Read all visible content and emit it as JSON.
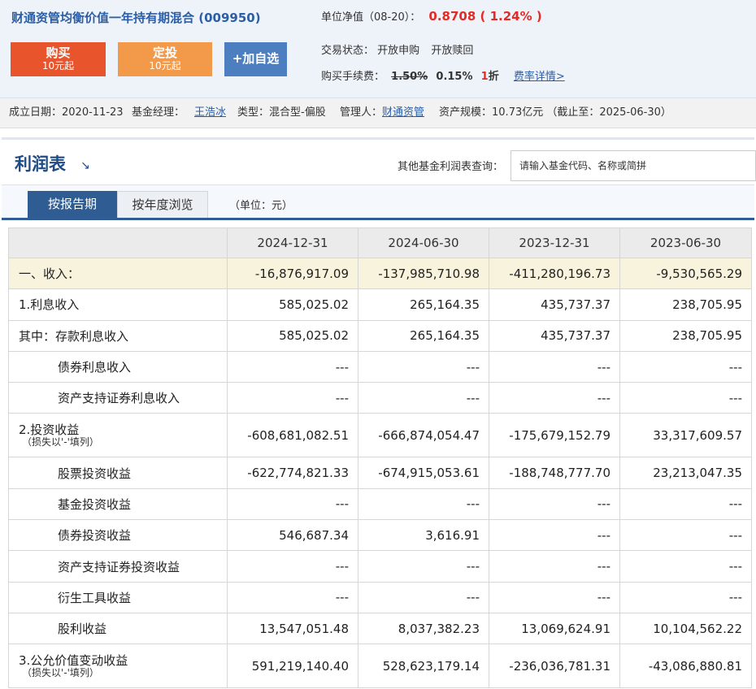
{
  "fund": {
    "title": "财通资管均衡价值一年持有期混合 (009950)",
    "nav_label": "单位净值（08-20）：",
    "nav_value": "0.8708 ( 1.24% )",
    "trade_status_label": "交易状态：",
    "trade_status_purchase": "开放申购",
    "trade_status_redeem": "开放赎回",
    "fee_label": "购买手续费：",
    "fee_original": "1.50%",
    "fee_current": "0.15%",
    "fee_discount_num": "1",
    "fee_discount_unit": "折",
    "fee_link": "费率详情>",
    "buttons": {
      "buy_main": "购买",
      "buy_sub": "10元起",
      "fixed_main": "定投",
      "fixed_sub": "10元起",
      "watch_main": "+加自选"
    }
  },
  "basic": {
    "established_label": "成立日期：",
    "established": "2020-11-23",
    "manager_label": "基金经理：",
    "manager": "王浩冰",
    "type_label": "类型：",
    "type": "混合型-偏股",
    "custodian_label": "管理人：",
    "custodian": "财通资管",
    "size_label": "资产规模：",
    "size": "10.73亿元 （截止至：2025-06-30）"
  },
  "section": {
    "title": "利润表",
    "lookup_label": "其他基金利润表查询：",
    "lookup_placeholder": "请输入基金代码、名称或简拼",
    "tab_report": "按报告期",
    "tab_annual": "按年度浏览",
    "unit": "（单位：元）"
  },
  "table": {
    "columns": [
      "2024-12-31",
      "2024-06-30",
      "2023-12-31",
      "2023-06-30"
    ],
    "rows": [
      {
        "label": "一、收入：",
        "values": [
          "-16,876,917.09",
          "-137,985,710.98",
          "-411,280,196.73",
          "-9,530,565.29"
        ]
      },
      {
        "label": "1.利息收入",
        "values": [
          "585,025.02",
          "265,164.35",
          "435,737.37",
          "238,705.95"
        ]
      },
      {
        "label": "其中：存款利息收入",
        "values": [
          "585,025.02",
          "265,164.35",
          "435,737.37",
          "238,705.95"
        ]
      },
      {
        "label": "债券利息收入",
        "values": [
          "---",
          "---",
          "---",
          "---"
        ]
      },
      {
        "label": "资产支持证券利息收入",
        "values": [
          "---",
          "---",
          "---",
          "---"
        ]
      },
      {
        "label": "2.投资收益",
        "note": "（损失以'-'填列）",
        "values": [
          "-608,681,082.51",
          "-666,874,054.47",
          "-175,679,152.79",
          "33,317,609.57"
        ]
      },
      {
        "label": "股票投资收益",
        "values": [
          "-622,774,821.33",
          "-674,915,053.61",
          "-188,748,777.70",
          "23,213,047.35"
        ]
      },
      {
        "label": "基金投资收益",
        "values": [
          "---",
          "---",
          "---",
          "---"
        ]
      },
      {
        "label": "债券投资收益",
        "values": [
          "546,687.34",
          "3,616.91",
          "---",
          "---"
        ]
      },
      {
        "label": "资产支持证券投资收益",
        "values": [
          "---",
          "---",
          "---",
          "---"
        ]
      },
      {
        "label": "衍生工具收益",
        "values": [
          "---",
          "---",
          "---",
          "---"
        ]
      },
      {
        "label": "股利收益",
        "values": [
          "13,547,051.48",
          "8,037,382.23",
          "13,069,624.91",
          "10,104,562.22"
        ]
      },
      {
        "label": "3.公允价值变动收益",
        "note": "（损失以'-'填列）",
        "values": [
          "591,219,140.40",
          "528,623,179.14",
          "-236,036,781.31",
          "-43,086,880.81"
        ]
      }
    ]
  },
  "colors": {
    "accent_blue": "#2e5c93",
    "price_red": "#e32b26",
    "buy_orange": "#e8552c",
    "fixed_orange": "#f39a4a",
    "watch_blue": "#4d7ec0",
    "highlight_row": "#f8f3dc"
  }
}
